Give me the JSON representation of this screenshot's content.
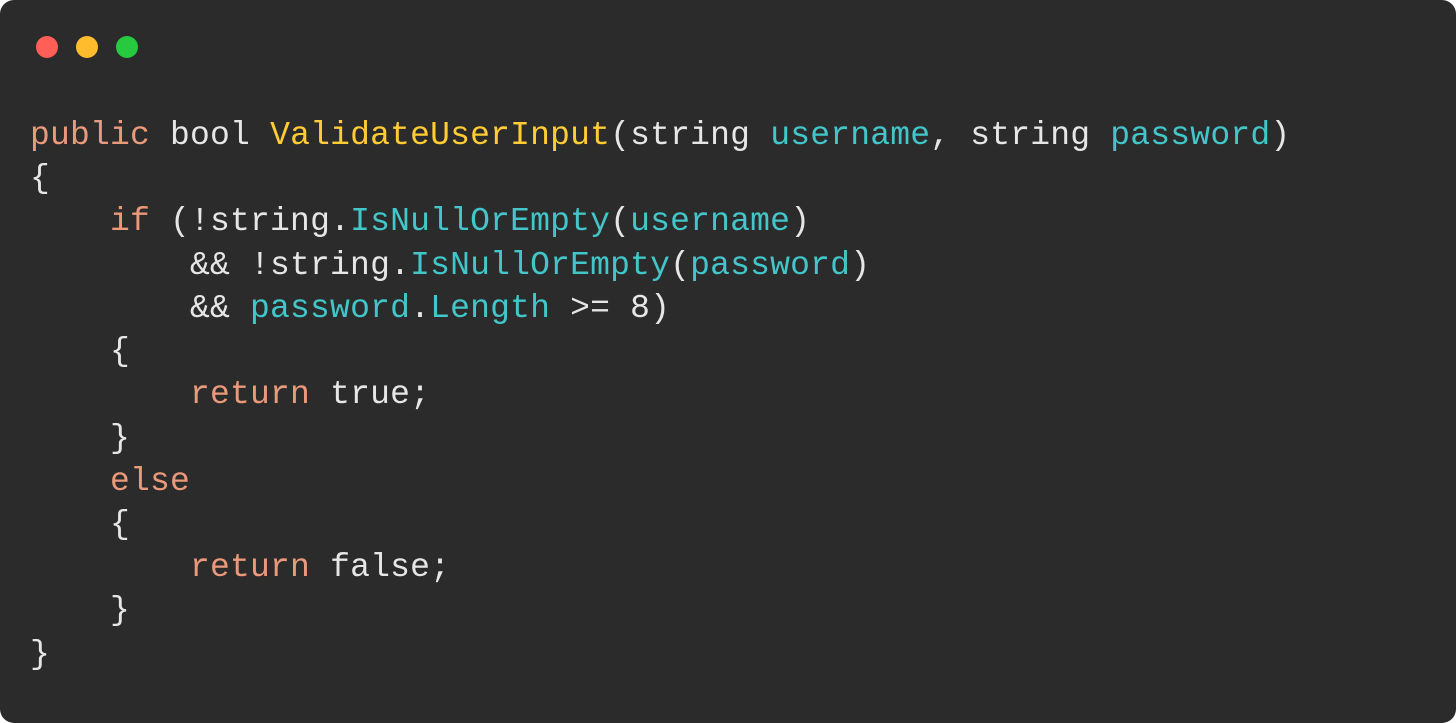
{
  "colors": {
    "background": "#2b2b2b",
    "text_default": "#e6e6e6",
    "keyword": "#ea9a7a",
    "method": "#ffcc33",
    "member": "#42c6c9",
    "param": "#42c6c9",
    "traffic_red": "#ff5f56",
    "traffic_yellow": "#ffbd2e",
    "traffic_green": "#27c93f"
  },
  "code": {
    "language": "csharp",
    "lines": [
      [
        {
          "t": "public",
          "c": "keyword"
        },
        {
          "t": " ",
          "c": "default"
        },
        {
          "t": "bool",
          "c": "type"
        },
        {
          "t": " ",
          "c": "default"
        },
        {
          "t": "ValidateUserInput",
          "c": "method"
        },
        {
          "t": "(",
          "c": "punct"
        },
        {
          "t": "string",
          "c": "type"
        },
        {
          "t": " ",
          "c": "default"
        },
        {
          "t": "username",
          "c": "param"
        },
        {
          "t": ", ",
          "c": "punct"
        },
        {
          "t": "string",
          "c": "type"
        },
        {
          "t": " ",
          "c": "default"
        },
        {
          "t": "password",
          "c": "param"
        },
        {
          "t": ")",
          "c": "punct"
        }
      ],
      [
        {
          "t": "{",
          "c": "punct"
        }
      ],
      [
        {
          "t": "    ",
          "c": "default"
        },
        {
          "t": "if",
          "c": "keyword"
        },
        {
          "t": " (!",
          "c": "punct"
        },
        {
          "t": "string",
          "c": "type"
        },
        {
          "t": ".",
          "c": "punct"
        },
        {
          "t": "IsNullOrEmpty",
          "c": "member"
        },
        {
          "t": "(",
          "c": "punct"
        },
        {
          "t": "username",
          "c": "param"
        },
        {
          "t": ")",
          "c": "punct"
        }
      ],
      [
        {
          "t": "        ",
          "c": "default"
        },
        {
          "t": "&& !",
          "c": "punct"
        },
        {
          "t": "string",
          "c": "type"
        },
        {
          "t": ".",
          "c": "punct"
        },
        {
          "t": "IsNullOrEmpty",
          "c": "member"
        },
        {
          "t": "(",
          "c": "punct"
        },
        {
          "t": "password",
          "c": "param"
        },
        {
          "t": ")",
          "c": "punct"
        }
      ],
      [
        {
          "t": "        ",
          "c": "default"
        },
        {
          "t": "&& ",
          "c": "punct"
        },
        {
          "t": "password",
          "c": "param"
        },
        {
          "t": ".",
          "c": "punct"
        },
        {
          "t": "Length",
          "c": "member"
        },
        {
          "t": " >= ",
          "c": "punct"
        },
        {
          "t": "8",
          "c": "number"
        },
        {
          "t": ")",
          "c": "punct"
        }
      ],
      [
        {
          "t": "    {",
          "c": "punct"
        }
      ],
      [
        {
          "t": "        ",
          "c": "default"
        },
        {
          "t": "return",
          "c": "keyword"
        },
        {
          "t": " ",
          "c": "default"
        },
        {
          "t": "true",
          "c": "bool"
        },
        {
          "t": ";",
          "c": "punct"
        }
      ],
      [
        {
          "t": "    }",
          "c": "punct"
        }
      ],
      [
        {
          "t": "    ",
          "c": "default"
        },
        {
          "t": "else",
          "c": "keyword"
        }
      ],
      [
        {
          "t": "    {",
          "c": "punct"
        }
      ],
      [
        {
          "t": "        ",
          "c": "default"
        },
        {
          "t": "return",
          "c": "keyword"
        },
        {
          "t": " ",
          "c": "default"
        },
        {
          "t": "false",
          "c": "bool"
        },
        {
          "t": ";",
          "c": "punct"
        }
      ],
      [
        {
          "t": "    }",
          "c": "punct"
        }
      ],
      [
        {
          "t": "}",
          "c": "punct"
        }
      ]
    ]
  }
}
